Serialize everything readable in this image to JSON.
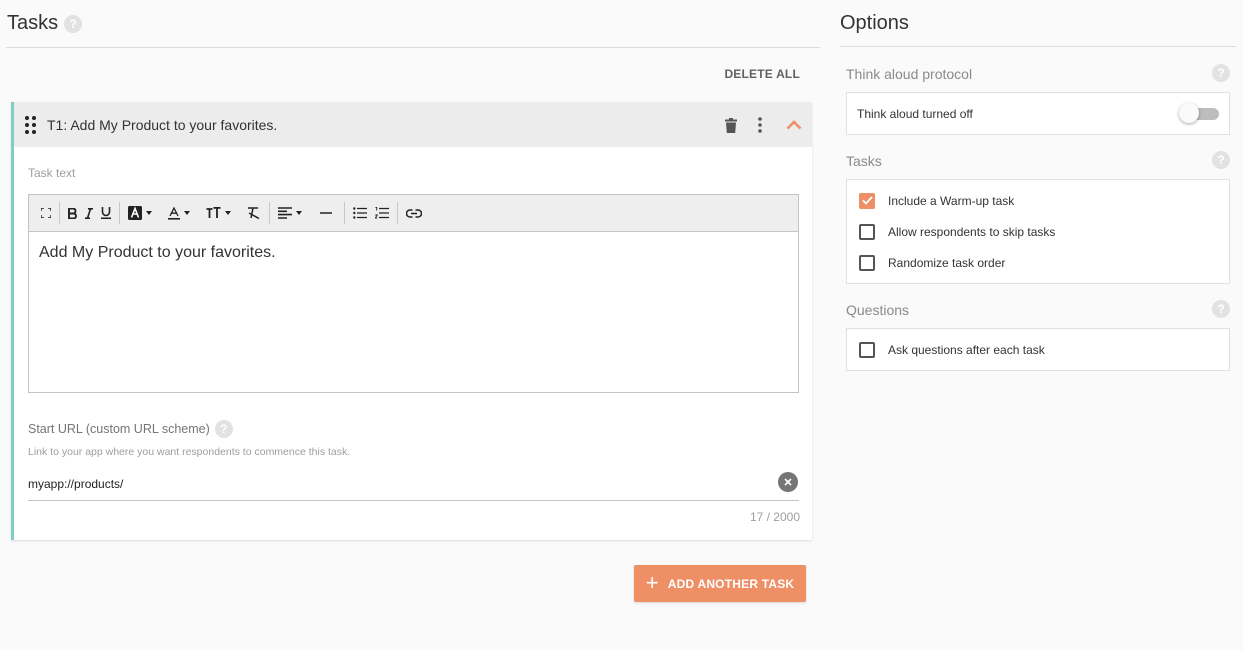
{
  "tasks_panel": {
    "title": "Tasks",
    "delete_all_label": "DELETE ALL",
    "task": {
      "title": "T1: Add My Product to your favorites.",
      "task_text_label": "Task text",
      "task_text_value": "Add My Product to your favorites.",
      "start_url_label": "Start URL (custom URL scheme)",
      "start_url_hint": "Link to your app where you want respondents to commence this task.",
      "start_url_value": "myapp://products/",
      "char_counter": "17 / 2000"
    },
    "add_task_label": "ADD ANOTHER TASK"
  },
  "options_panel": {
    "title": "Options",
    "think_aloud": {
      "label": "Think aloud protocol",
      "toggle_text": "Think aloud turned off",
      "enabled": false
    },
    "tasks": {
      "label": "Tasks",
      "items": [
        {
          "label": "Include a Warm-up task",
          "checked": true
        },
        {
          "label": "Allow respondents to skip tasks",
          "checked": false
        },
        {
          "label": "Randomize task order",
          "checked": false
        }
      ]
    },
    "questions": {
      "label": "Questions",
      "items": [
        {
          "label": "Ask questions after each task",
          "checked": false
        }
      ]
    }
  },
  "help_glyph": "?",
  "colors": {
    "accent": "#ee8f66",
    "task_border": "#7fcfc9",
    "header_bg": "#ececec"
  }
}
